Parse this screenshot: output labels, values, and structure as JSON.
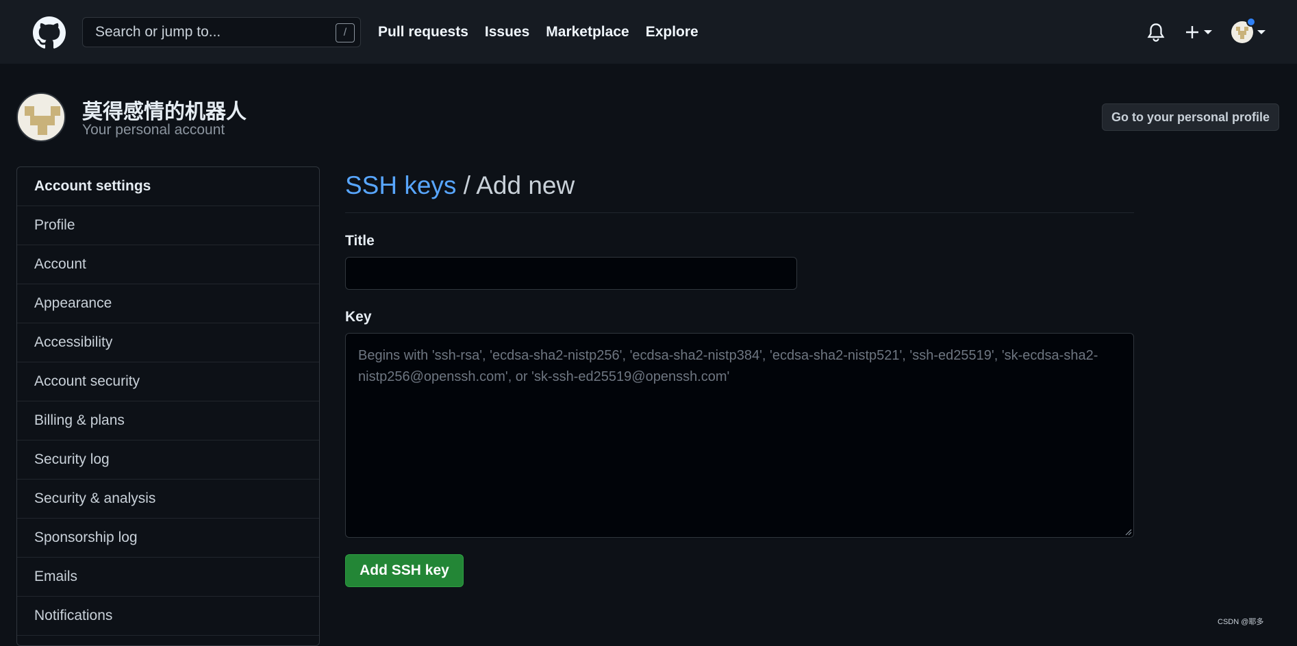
{
  "header": {
    "search_placeholder": "Search or jump to...",
    "search_key": "/",
    "nav": [
      "Pull requests",
      "Issues",
      "Marketplace",
      "Explore"
    ],
    "icons": [
      "github-logo-icon",
      "bell-icon",
      "plus-icon",
      "avatar"
    ]
  },
  "account": {
    "name": "莫得感情的机器人",
    "subtitle": "Your personal account",
    "profile_button": "Go to your personal profile"
  },
  "sidebar": {
    "heading": "Account settings",
    "items": [
      "Profile",
      "Account",
      "Appearance",
      "Accessibility",
      "Account security",
      "Billing & plans",
      "Security log",
      "Security & analysis",
      "Sponsorship log",
      "Emails",
      "Notifications"
    ]
  },
  "main": {
    "title_link": "SSH keys",
    "title_rest": " / Add new",
    "title_label": "Title",
    "title_value": "",
    "key_label": "Key",
    "key_placeholder": "Begins with 'ssh-rsa', 'ecdsa-sha2-nistp256', 'ecdsa-sha2-nistp384', 'ecdsa-sha2-nistp521', 'ssh-ed25519', 'sk-ecdsa-sha2-nistp256@openssh.com', or 'sk-ssh-ed25519@openssh.com'",
    "submit_label": "Add SSH key"
  },
  "watermark": "CSDN @耶多",
  "colors": {
    "background": "#0d1117",
    "header": "#161b22",
    "link": "#58a6ff",
    "primary_button": "#238636",
    "notification_dot": "#2f81f7"
  }
}
